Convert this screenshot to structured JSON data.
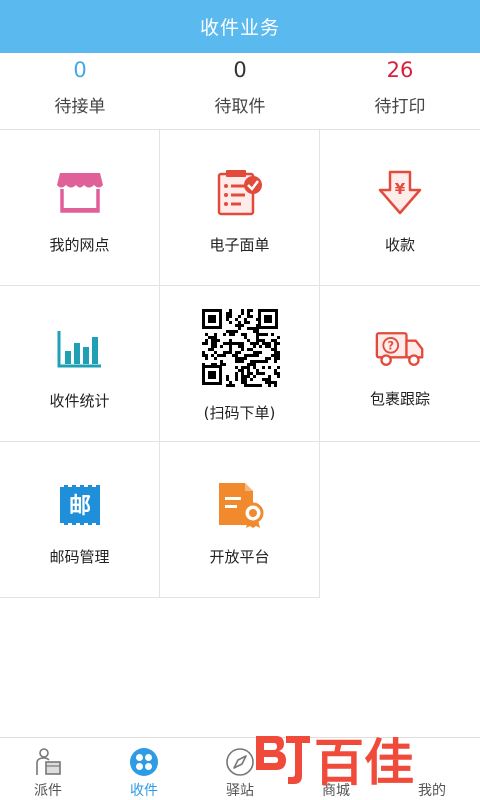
{
  "header": {
    "title": "收件业务"
  },
  "stats": [
    {
      "value": "0",
      "label": "待接单",
      "color": "#44a9e6"
    },
    {
      "value": "0",
      "label": "待取件",
      "color": "#333333"
    },
    {
      "value": "26",
      "label": "待打印",
      "color": "#d7203b"
    }
  ],
  "grid": [
    {
      "label": "我的网点",
      "icon": "storefront-icon"
    },
    {
      "label": "电子面单",
      "icon": "checklist-icon"
    },
    {
      "label": "收款",
      "icon": "yen-arrow-icon"
    },
    {
      "label": "收件统计",
      "icon": "bar-chart-icon"
    },
    {
      "label": "(扫码下单)",
      "icon": "qr-code-icon"
    },
    {
      "label": "包裹跟踪",
      "icon": "delivery-truck-icon"
    },
    {
      "label": "邮码管理",
      "icon": "postal-stamp-icon"
    },
    {
      "label": "开放平台",
      "icon": "certificate-icon"
    }
  ],
  "tabbar": [
    {
      "label": "派件",
      "icon": "courier-box-icon"
    },
    {
      "label": "收件",
      "icon": "grid-dots-icon",
      "active": true
    },
    {
      "label": "驿站",
      "icon": "compass-icon"
    },
    {
      "label": "商城",
      "icon": "shop-icon"
    },
    {
      "label": "我的",
      "icon": "user-icon"
    }
  ],
  "watermark": {
    "text": "百佳"
  },
  "colors": {
    "header": "#5ab9ee",
    "accent": "#2e9be6",
    "red": "#e24b3c",
    "pink": "#e0609a",
    "teal": "#1fa0b5",
    "blue": "#1e8fd8",
    "orange": "#f08a2c"
  }
}
